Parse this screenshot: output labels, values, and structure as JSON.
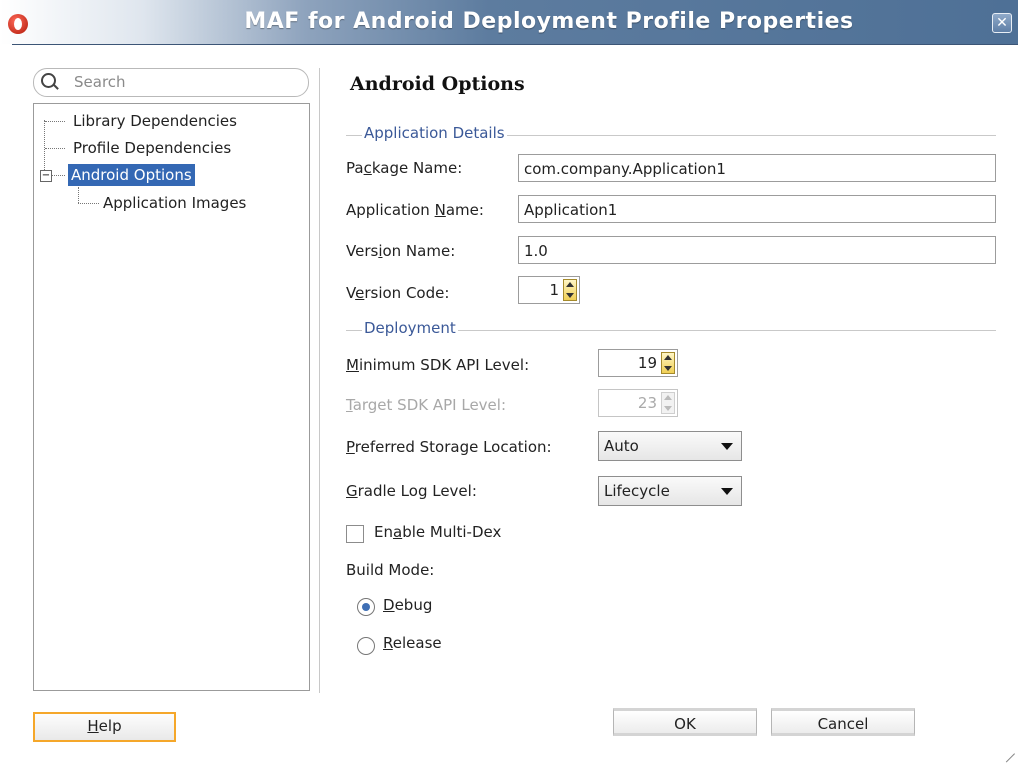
{
  "window": {
    "title": "MAF for Android Deployment Profile Properties",
    "close_glyph": "✕"
  },
  "search": {
    "placeholder": "Search"
  },
  "tree": {
    "items": [
      {
        "label": "Library Dependencies"
      },
      {
        "label": "Profile Dependencies"
      },
      {
        "label": "Android Options",
        "selected": true,
        "expanded": true
      },
      {
        "label": "Application Images"
      }
    ],
    "expander_glyph": "−"
  },
  "panel": {
    "title": "Android Options",
    "application_details": {
      "section_label": "Application Details",
      "package_name": {
        "label_pre": "Pa",
        "label_key": "c",
        "label_post": "kage Name:",
        "value": "com.company.Application1"
      },
      "application_name": {
        "label_pre": "Application ",
        "label_key": "N",
        "label_post": "ame:",
        "value": "Application1"
      },
      "version_name": {
        "label_pre": "Vers",
        "label_key": "i",
        "label_post": "on Name:",
        "value": "1.0"
      },
      "version_code": {
        "label_pre": "V",
        "label_key": "e",
        "label_post": "rsion Code:",
        "value": "1"
      }
    },
    "deployment": {
      "section_label": "Deployment",
      "min_sdk": {
        "label_key": "M",
        "label_post": "inimum SDK API Level:",
        "value": "19"
      },
      "target_sdk": {
        "label_key": "T",
        "label_post": "arget SDK API Level:",
        "value": "23",
        "enabled": false
      },
      "storage": {
        "label_key": "P",
        "label_post": "referred Storage Location:",
        "value": "Auto"
      },
      "gradle": {
        "label_key": "G",
        "label_post": "radle Log Level:",
        "value": "Lifecycle"
      },
      "multidex": {
        "label_pre": "En",
        "label_key": "a",
        "label_post": "ble Multi-Dex",
        "checked": false
      },
      "build_mode": {
        "label": "Build Mode:",
        "debug": {
          "label_key": "D",
          "label_post": "ebug",
          "selected": true
        },
        "release": {
          "label_key": "R",
          "label_post": "elease",
          "selected": false
        }
      }
    }
  },
  "buttons": {
    "help": {
      "label_key": "H",
      "label_post": "elp"
    },
    "ok": "OK",
    "cancel": "Cancel"
  },
  "colors": {
    "selection": "#3468b4",
    "section_text": "#3b5998",
    "focus_border": "#f5a72a"
  }
}
